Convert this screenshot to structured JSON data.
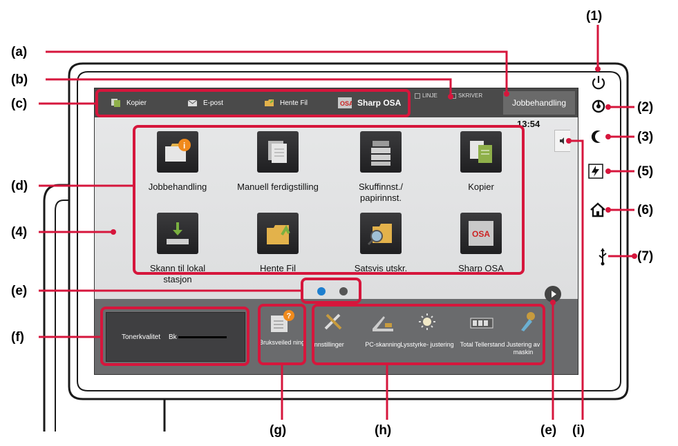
{
  "callouts": {
    "c1": "(1)",
    "c2": "(2)",
    "c3": "(3)",
    "c4": "(4)",
    "c5": "(5)",
    "c6": "(6)",
    "c7": "(7)",
    "a": "(a)",
    "b": "(b)",
    "c": "(c)",
    "d": "(d)",
    "e_left": "(e)",
    "e_bottom": "(e)",
    "f": "(f)",
    "g": "(g)",
    "h": "(h)",
    "i": "(i)"
  },
  "tab_bar": {
    "tabs": [
      {
        "label": "Kopier",
        "icon": "copy-icon"
      },
      {
        "label": "E-post",
        "icon": "mail-icon"
      },
      {
        "label": "Hente Fil",
        "icon": "folder-icon"
      },
      {
        "label": "Sharp OSA",
        "icon": "osa-icon"
      }
    ],
    "status_linje": "LINJE",
    "status_skriver": "SKRIVER",
    "job_button": "Jobbehandling"
  },
  "clock": "13:54",
  "apps": [
    {
      "label": "Jobbehandling",
      "icon": "job-status-icon"
    },
    {
      "label": "Manuell ferdigstilling",
      "icon": "document-stack-icon"
    },
    {
      "label": "Skuffinnst./ papirinnst.",
      "icon": "tray-icon"
    },
    {
      "label": "Kopier",
      "icon": "copy-icon"
    },
    {
      "label": "Skann til lokal stasjon",
      "icon": "scan-drive-icon"
    },
    {
      "label": "Hente Fil",
      "icon": "folder-icon"
    },
    {
      "label": "Satsvis utskr.",
      "icon": "search-folder-icon"
    },
    {
      "label": "Sharp OSA",
      "icon": "osa-icon"
    }
  ],
  "toner": {
    "label": "Tonerkvalitet",
    "channel": "Bk"
  },
  "guide": {
    "label": "Bruksveiled ning",
    "icon": "help-book-icon"
  },
  "shortcuts": [
    {
      "label": "Innstillinger",
      "icon": "tools-icon"
    },
    {
      "label": "PC-skanning",
      "icon": "scanner-icon"
    },
    {
      "label": "Lysstyrke- justering",
      "icon": "brightness-icon"
    },
    {
      "label": "Total Tellerstand",
      "icon": "counter-icon"
    },
    {
      "label": "Justering av maskin",
      "icon": "wrench-icon"
    }
  ],
  "colors": {
    "callout": "#d6163c",
    "dot_active": "#1e7fcf",
    "dot_inactive": "#555555"
  }
}
